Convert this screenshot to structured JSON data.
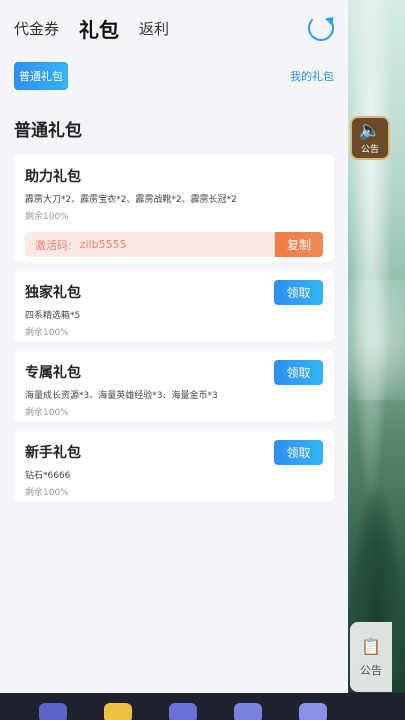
{
  "header": {
    "tabs": [
      {
        "label": "代金券"
      },
      {
        "label": "礼包"
      },
      {
        "label": "返利"
      }
    ],
    "refresh_icon": "refresh-icon"
  },
  "subbar": {
    "chip_label": "普通礼包",
    "my_gifts_link": "我的礼包"
  },
  "section": {
    "title": "普通礼包"
  },
  "gifts": [
    {
      "title": "助力礼包",
      "desc": "霹雳大刀*2、霹雳宝衣*2、霹雳战靴*2、霹雳长冠*2",
      "remain": "剩余100%",
      "code_label": "激活码:",
      "code_value": "zilb5555",
      "copy_label": "复制"
    },
    {
      "title": "独家礼包",
      "desc": "四系精选箱*5",
      "remain": "剩余100%",
      "action_label": "领取"
    },
    {
      "title": "专属礼包",
      "desc": "海量成长资源*3、海量英雄经验*3、海量金币*3",
      "remain": "剩余100%",
      "action_label": "领取"
    },
    {
      "title": "新手礼包",
      "desc": "钻石*6666",
      "remain": "剩余100%",
      "action_label": "领取"
    }
  ],
  "side": {
    "speaker_label": "公告",
    "notice_label": "公告"
  },
  "colors": {
    "accent": "#2f8ef0",
    "copy": "#f27a45",
    "code_bg": "#fde9e6"
  }
}
